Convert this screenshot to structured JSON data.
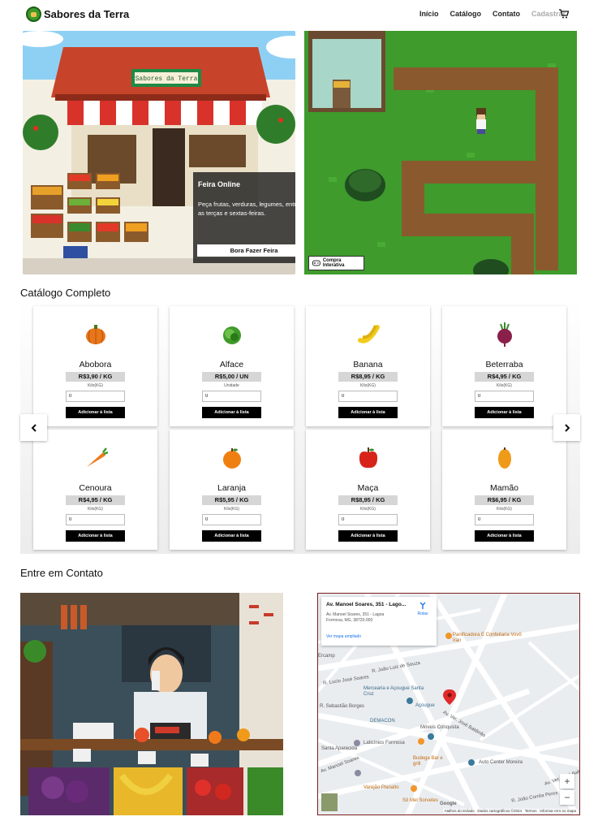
{
  "brand": {
    "name": "Sabores da Terra"
  },
  "nav": {
    "items": [
      {
        "label": "Início",
        "state": "active"
      },
      {
        "label": "Catálogo",
        "state": "default"
      },
      {
        "label": "Contato",
        "state": "default"
      },
      {
        "label": "Cadastrar",
        "state": "muted"
      }
    ],
    "cart_icon": "cart-icon"
  },
  "hero": {
    "sign": "Sabores da Terra",
    "card": {
      "title": "Feira Online",
      "description": "Peça frutas, verduras, legumes, entregas as terças e sextas-feiras.",
      "button": "Bora Fazer Feira"
    },
    "interactive_button": "Compra Interativa"
  },
  "catalog": {
    "title": "Catálogo Completo",
    "add_label": "Adicionar à lista",
    "qty_default": "0",
    "products": [
      {
        "name": "Abobora",
        "price": "R$3,90 / KG",
        "unit": "Kilo(KG)",
        "icon": "pumpkin-icon",
        "color": "#e8761a"
      },
      {
        "name": "Alface",
        "price": "R$5,00 / UN",
        "unit": "Unidade",
        "icon": "lettuce-icon",
        "color": "#3f9a2a"
      },
      {
        "name": "Banana",
        "price": "R$8,95 / KG",
        "unit": "Kilo(KG)",
        "icon": "banana-icon",
        "color": "#f2cc1d"
      },
      {
        "name": "Beterraba",
        "price": "R$4,95 / KG",
        "unit": "Kilo(KG)",
        "icon": "beet-icon",
        "color": "#8a1f4a"
      },
      {
        "name": "Cenoura",
        "price": "R$4,95 / KG",
        "unit": "Kilo(KG)",
        "icon": "carrot-icon",
        "color": "#ee7a1c"
      },
      {
        "name": "Laranja",
        "price": "R$5,95 / KG",
        "unit": "Kilo(KG)",
        "icon": "orange-icon",
        "color": "#f07f12"
      },
      {
        "name": "Maça",
        "price": "R$8,95 / KG",
        "unit": "Kilo(KG)",
        "icon": "apple-icon",
        "color": "#d8231a"
      },
      {
        "name": "Mamão",
        "price": "R$6,95 / KG",
        "unit": "Kilo(KG)",
        "icon": "papaya-icon",
        "color": "#f09a1a"
      }
    ]
  },
  "contact": {
    "title": "Entre em Contato"
  },
  "map": {
    "place_title": "Av. Manoel Soares, 351 - Lago...",
    "address": "Av. Manoel Soares, 351 - Lagoa Formosa, MG, 38720-000",
    "larger_map": "Ver mapa ampliado",
    "routes": "Rotas",
    "labels": [
      "Panificadora E Confeitaria Vovô Iran",
      "Mercearia e Açougue Santa Cruz",
      "Açougue",
      "DEMACON",
      "Móveis Conquista",
      "Laticínios Formosa",
      "Budega Bar e grill",
      "Auto Center Moreira",
      "Varejão Planalto",
      "Sô Mel Sorvetes",
      "R. João Luiz de Souza",
      "R. Lucio José Soares",
      "Av. Ver. José Baldinão",
      "Av. Manoel Soares",
      "R. Sebastião Borges",
      "Av. Ver. José Bald",
      "R. João Corrêa Peres",
      "Santa Aparecida",
      "Ercamp"
    ],
    "attribution": [
      "Atalhos do teclado",
      "Dados cartográficos ©2024",
      "Termos",
      "Informar erro no mapa"
    ],
    "google": "Google"
  }
}
